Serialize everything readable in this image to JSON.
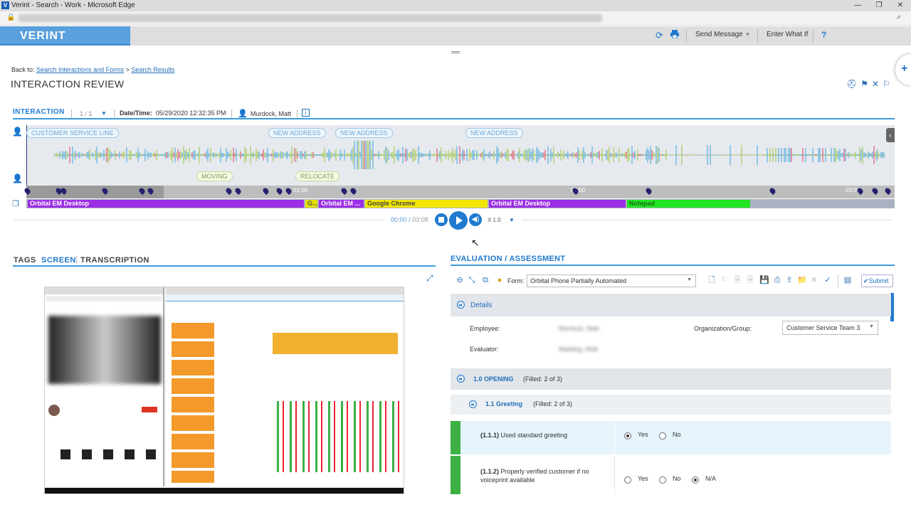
{
  "browser": {
    "title": "Verint - Search - Work - Microsoft Edge"
  },
  "header": {
    "logo": "VERINT",
    "send_message": "Send Message",
    "enter_what_if": "Enter What If",
    "help": "?"
  },
  "breadcrumb": {
    "prefix": "Back to:",
    "link1": "Search Interactions and Forms",
    "separator": ">",
    "link2": "Search Results"
  },
  "page_title": "INTERACTION REVIEW",
  "interaction": {
    "label": "INTERACTION",
    "count": "1 / 1",
    "date_label": "Date/Time:",
    "date_value": "05/29/2020 12:32:35 PM",
    "user": "Murdock, Matt"
  },
  "tags": {
    "customer_service_line": "CUSTOMER SERVICE LINE",
    "new_address_1": "NEW ADDRESS",
    "new_address_2": "NEW ADDRESS",
    "new_address_3": "NEW ADDRESS",
    "moving": "MOVING",
    "relocate": "RELOCATE"
  },
  "timeline": {
    "t1": "01:00",
    "t2": "02:00",
    "t3": "03:00"
  },
  "apps": [
    {
      "label": "Orbital EM Desktop",
      "color": "#9b2ee6"
    },
    {
      "label": "G...",
      "color": "#e6e000"
    },
    {
      "label": "Orbital EM ...",
      "color": "#9b2ee6"
    },
    {
      "label": "Google Chrome",
      "color": "#f2e600"
    },
    {
      "label": "Orbital EM Desktop",
      "color": "#9b2ee6"
    },
    {
      "label": "Notepad",
      "color": "#21e621"
    }
  ],
  "player": {
    "current": "00:00",
    "separator": "/",
    "total": "03:08",
    "speed": "X 1.0"
  },
  "left_tabs": {
    "tags": "TAGS",
    "screen": "SCREEN",
    "transcription": "TRANSCRIPTION"
  },
  "evaluation": {
    "title": "EVALUATION / ASSESSMENT",
    "form_label": "Form:",
    "form_value": "Orbital Phone Partially Automated",
    "submit": "Submit",
    "details": "Details",
    "employee_label": "Employee:",
    "employee_value": "Murdock, Matt",
    "evaluator_label": "Evaluator:",
    "evaluator_value": "Maddog, Matt",
    "org_label": "Organization/Group:",
    "org_value": "Customer Service Team 3",
    "opening": "1.0 OPENING",
    "opening_filled": "(Filled: 2 of 3)",
    "greeting": "1.1 Greeting",
    "greeting_filled": "(Filled: 2 of 3)",
    "q1_num": "(1.1.1)",
    "q1_text": "Used standard greeting",
    "q2_num": "(1.1.2)",
    "q2_text": "Properly verified customer if no voiceprint available",
    "yes": "Yes",
    "no": "No",
    "na": "N/A"
  },
  "colors": {
    "accent": "#1f7ad0",
    "logo_bg": "#5aa0dc",
    "green_bar": "#3cb043"
  }
}
